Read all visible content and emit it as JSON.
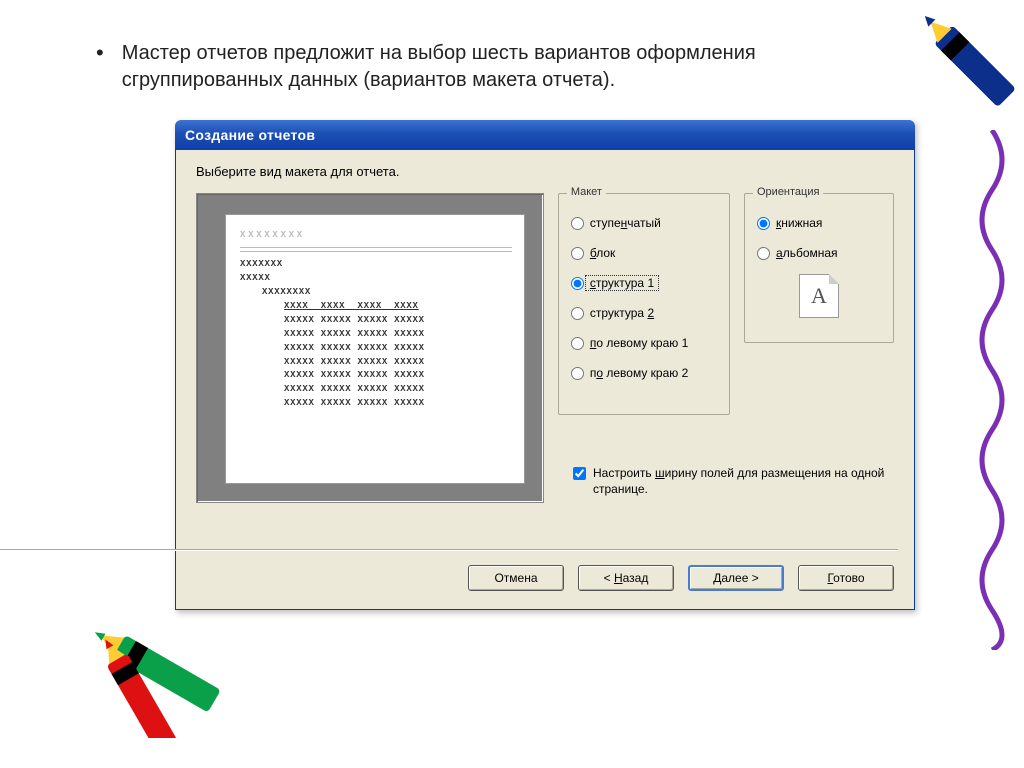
{
  "slide_text": "Мастер отчетов предложит на выбор шесть вариантов оформления сгруппированных данных (вариантов макета отчета).",
  "dialog": {
    "title": "Создание отчетов",
    "instruction": "Выберите вид макета для отчета.",
    "layout_group_title": "Макет",
    "orientation_group_title": "Ориентация",
    "layout_options": [
      {
        "label": "ступенчатый",
        "underline_index": 5,
        "selected": false
      },
      {
        "label": "блок",
        "underline_index": 0,
        "selected": false
      },
      {
        "label": "структура 1",
        "underline_index": 0,
        "selected": true
      },
      {
        "label": "структура 2",
        "underline_index": 10,
        "selected": false
      },
      {
        "label": "по левому краю 1",
        "underline_index": 0,
        "selected": false
      },
      {
        "label": "по левому краю 2",
        "underline_index": 1,
        "selected": false
      }
    ],
    "orientation_options": [
      {
        "label": "книжная",
        "underline_index": 0,
        "selected": true
      },
      {
        "label": "альбомная",
        "underline_index": 0,
        "selected": false
      }
    ],
    "orientation_icon_letter": "A",
    "checkbox_label": "Настроить ширину полей для размещения на одной странице.",
    "checkbox_underline_index": 10,
    "checkbox_checked": true,
    "buttons": {
      "cancel": "Отмена",
      "back": "< Назад",
      "back_underline_index": 2,
      "next": "Далее >",
      "finish": "Готово",
      "finish_underline_index": 0
    },
    "preview": {
      "h1": "XXXXXXXX",
      "g1": "XXXXXXX",
      "g2": "XXXXX",
      "g3": "XXXXXXXX",
      "head": "XXXX  XXXX  XXXX  XXXX",
      "row": "XXXXX XXXXX XXXXX XXXXX",
      "rows": 7
    }
  }
}
